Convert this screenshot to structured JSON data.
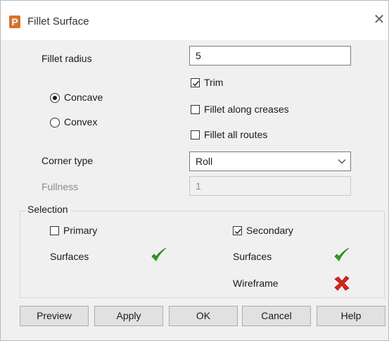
{
  "window": {
    "title": "Fillet Surface",
    "app_icon_letter": "P",
    "close_glyph": "✕"
  },
  "fillet_radius": {
    "label": "Fillet radius",
    "value": "5"
  },
  "shape": {
    "concave_label": "Concave",
    "concave_selected": true,
    "convex_label": "Convex",
    "convex_selected": false
  },
  "options": {
    "trim_label": "Trim",
    "trim_checked": true,
    "fillet_along_creases_label": "Fillet along creases",
    "fillet_along_creases_checked": false,
    "fillet_all_routes_label": "Fillet all routes",
    "fillet_all_routes_checked": false
  },
  "corner_type": {
    "label": "Corner type",
    "value": "Roll"
  },
  "fullness": {
    "label": "Fullness",
    "value": "1",
    "enabled": false
  },
  "selection": {
    "title": "Selection",
    "primary": {
      "label": "Primary",
      "checked": false,
      "surfaces_label": "Surfaces",
      "surfaces_status": "ok"
    },
    "secondary": {
      "label": "Secondary",
      "checked": true,
      "surfaces_label": "Surfaces",
      "surfaces_status": "ok",
      "wireframe_label": "Wireframe",
      "wireframe_status": "error"
    }
  },
  "buttons": {
    "preview": "Preview",
    "apply": "Apply",
    "ok": "OK",
    "cancel": "Cancel",
    "help": "Help"
  },
  "colors": {
    "ok_green": "#2e9e1c",
    "error_red": "#d8231b",
    "app_orange": "#d8722a"
  }
}
